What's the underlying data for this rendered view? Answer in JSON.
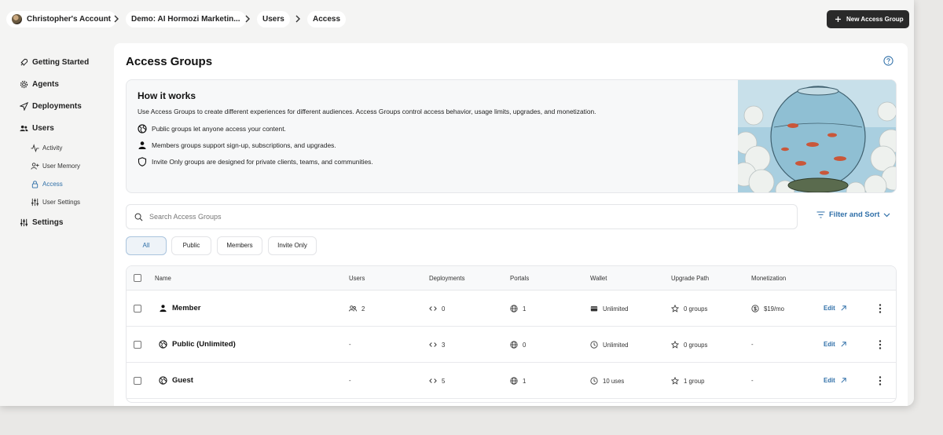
{
  "breadcrumb": {
    "account": "Christopher's Account",
    "project": "Demo: AI Hormozi Marketin...",
    "section": "Users",
    "page": "Access"
  },
  "header": {
    "new_group_label": "New Access Group"
  },
  "sidebar": {
    "items": [
      {
        "label": "Getting Started",
        "icon": "rocket-icon"
      },
      {
        "label": "Agents",
        "icon": "gear-icon"
      },
      {
        "label": "Deployments",
        "icon": "send-icon"
      },
      {
        "label": "Users",
        "icon": "users-icon"
      }
    ],
    "sub_items": [
      {
        "label": "Activity",
        "icon": "pulse-icon"
      },
      {
        "label": "User Memory",
        "icon": "user-plus-icon"
      },
      {
        "label": "Access",
        "icon": "lock-icon",
        "active": true
      },
      {
        "label": "User Settings",
        "icon": "sliders-icon"
      }
    ],
    "settings": {
      "label": "Settings",
      "icon": "sliders-icon"
    }
  },
  "main": {
    "title": "Access Groups",
    "how": {
      "title": "How it works",
      "description": "Use Access Groups to create different experiences for different audiences. Access Groups control access behavior, usage limits, upgrades, and monetization.",
      "items": [
        {
          "icon": "globe-icon",
          "text": "Public groups let anyone access your content."
        },
        {
          "icon": "person-icon",
          "text": "Members groups support sign-up, subscriptions, and upgrades."
        },
        {
          "icon": "shield-icon",
          "text": "Invite Only groups are designed for private clients, teams, and communities."
        }
      ]
    },
    "search": {
      "placeholder": "Search Access Groups"
    },
    "filter_label": "Filter and Sort",
    "tabs": [
      "All",
      "Public",
      "Members",
      "Invite Only"
    ],
    "selected_tab": "All",
    "table": {
      "columns": [
        "Name",
        "Users",
        "Deployments",
        "Portals",
        "Wallet",
        "Upgrade Path",
        "Monetization"
      ],
      "rows": [
        {
          "icon": "person-icon",
          "name": "Member",
          "users": "2",
          "deployments": "0",
          "portals": "1",
          "wallet": "Unlimited",
          "upgrade": "0 groups",
          "monetization": "$19/mo",
          "edit": "Edit"
        },
        {
          "icon": "globe-icon",
          "name": "Public (Unlimited)",
          "users": "-",
          "deployments": "3",
          "portals": "0",
          "wallet": "Unlimited",
          "upgrade": "0 groups",
          "monetization": "-",
          "edit": "Edit"
        },
        {
          "icon": "globe-icon",
          "name": "Guest",
          "users": "-",
          "deployments": "5",
          "portals": "1",
          "wallet": "10 uses",
          "upgrade": "1 group",
          "monetization": "-",
          "edit": "Edit"
        }
      ]
    }
  },
  "colors": {
    "accent": "#2f6fa8",
    "dark_button": "#2a2a2a"
  }
}
